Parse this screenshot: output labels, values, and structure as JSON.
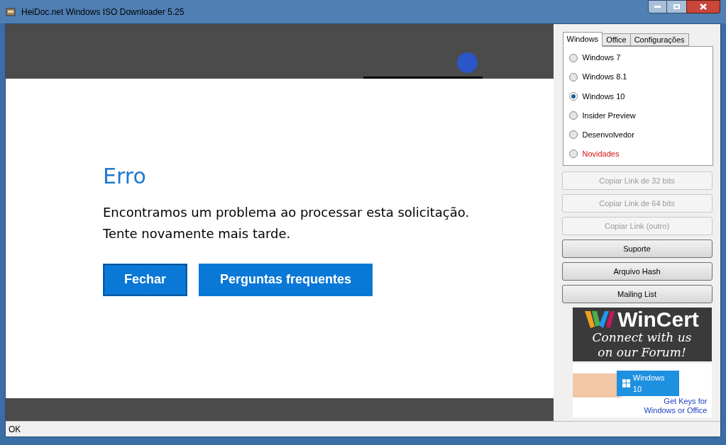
{
  "window": {
    "title": "HeiDoc.net Windows ISO Downloader 5.25"
  },
  "page": {
    "heading": "Erro",
    "message": "Encontramos um problema ao processar esta solicitação.",
    "message2": "Tente novamente mais tarde.",
    "buttons": [
      {
        "label": "Fechar",
        "focused": true
      },
      {
        "label": "Perguntas frequentes",
        "focused": false
      }
    ]
  },
  "tabs": [
    {
      "label": "Windows",
      "selected": true
    },
    {
      "label": "Office",
      "selected": false
    },
    {
      "label": "Configurações",
      "selected": false
    }
  ],
  "options": [
    {
      "label": "Windows 7",
      "selected": false,
      "highlight": false
    },
    {
      "label": "Windows 8.1",
      "selected": false,
      "highlight": false
    },
    {
      "label": "Windows 10",
      "selected": true,
      "highlight": false
    },
    {
      "label": "Insider Preview",
      "selected": false,
      "highlight": false
    },
    {
      "label": "Desenvolvedor",
      "selected": false,
      "highlight": false
    },
    {
      "label": "Novidades",
      "selected": false,
      "highlight": true
    }
  ],
  "actions": [
    {
      "label": "Copiar Link de 32 bits",
      "disabled": true
    },
    {
      "label": "Copiar Link de 64 bits",
      "disabled": true
    },
    {
      "label": "Copiar Link (outro)",
      "disabled": true
    },
    {
      "label": "Suporte",
      "disabled": false
    },
    {
      "label": "Arquivo Hash",
      "disabled": false
    },
    {
      "label": "Mailing List",
      "disabled": false
    }
  ],
  "banners": [
    {
      "kind": "forum",
      "title": "WinCert",
      "line1": "Connect with us",
      "line2": "on our Forum!"
    },
    {
      "kind": "keys",
      "card": "Windows 10",
      "line1": "Get Keys for",
      "line2": "Windows or Office"
    }
  ],
  "status_bar": {
    "text": "OK"
  }
}
